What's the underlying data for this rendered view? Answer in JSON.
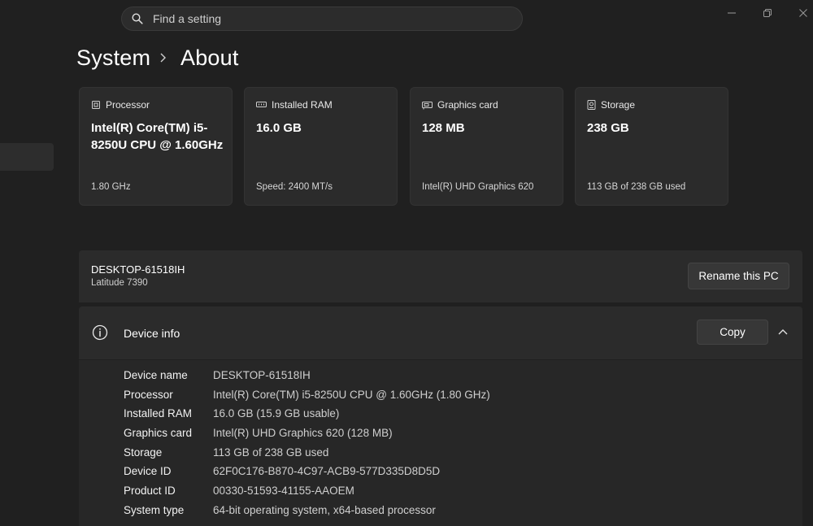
{
  "search": {
    "placeholder": "Find a setting"
  },
  "breadcrumb": {
    "parent": "System",
    "current": "About"
  },
  "specs": [
    {
      "icon": "processor-icon",
      "label": "Processor",
      "value": "Intel(R) Core(TM) i5-8250U CPU @ 1.60GHz",
      "sub": "1.80 GHz"
    },
    {
      "icon": "ram-icon",
      "label": "Installed RAM",
      "value": "16.0 GB",
      "sub": "Speed: 2400 MT/s"
    },
    {
      "icon": "graphics-card-icon",
      "label": "Graphics card",
      "value": "128 MB",
      "sub": "Intel(R) UHD Graphics 620"
    },
    {
      "icon": "storage-icon",
      "label": "Storage",
      "value": "238 GB",
      "sub": "113 GB of 238 GB used"
    }
  ],
  "pc": {
    "name": "DESKTOP-61518IH",
    "model": "Latitude 7390",
    "rename_label": "Rename this PC"
  },
  "device_info": {
    "title": "Device info",
    "copy_label": "Copy",
    "rows": [
      {
        "label": "Device name",
        "value": "DESKTOP-61518IH"
      },
      {
        "label": "Processor",
        "value": "Intel(R) Core(TM) i5-8250U CPU @ 1.60GHz (1.80 GHz)"
      },
      {
        "label": "Installed RAM",
        "value": "16.0 GB (15.9 GB usable)"
      },
      {
        "label": "Graphics card",
        "value": "Intel(R) UHD Graphics 620 (128 MB)"
      },
      {
        "label": "Storage",
        "value": "113 GB of 238 GB used"
      },
      {
        "label": "Device ID",
        "value": "62F0C176-B870-4C97-ACB9-577D335D8D5D"
      },
      {
        "label": "Product ID",
        "value": "00330-51593-41155-AAOEM"
      },
      {
        "label": "System type",
        "value": "64-bit operating system, x64-based processor"
      }
    ]
  }
}
